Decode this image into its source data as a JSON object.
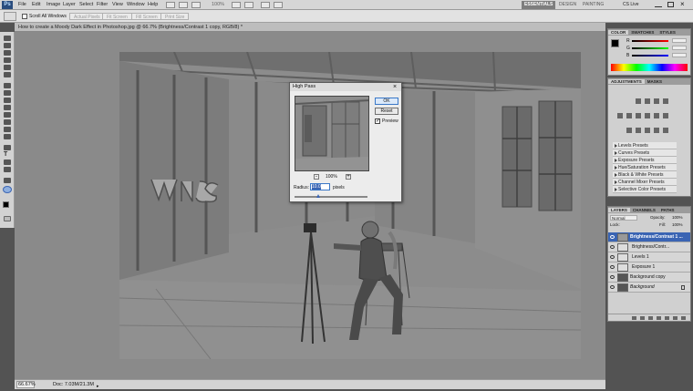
{
  "menubar": {
    "logo": "Ps",
    "items": [
      "File",
      "Edit",
      "Image",
      "Layer",
      "Select",
      "Filter",
      "View",
      "Window",
      "Help"
    ],
    "zoom": "100%",
    "workspaces": [
      "ESSENTIALS",
      "DESIGN",
      "PAINTING"
    ],
    "cs_live": "CS Live"
  },
  "options": {
    "scroll_all_windows": "Scroll All Windows",
    "actual_pixels": "Actual Pixels",
    "fit_screen": "Fit Screen",
    "fill_screen": "Fill Screen",
    "print_size": "Print Size"
  },
  "document": {
    "tab_title": "How to create a Moody Dark Effect in Photoshop.jpg @ 66.7% (Brightness/Contrast 1 copy, RGB/8) *",
    "zoom": "66.67%",
    "doc_size": "Doc: 7.03M/21.3M"
  },
  "high_pass": {
    "title": "High Pass",
    "ok": "OK",
    "cancel": "Reset",
    "preview": "Preview",
    "preview_checked": true,
    "preview_zoom": "100%",
    "radius_label": "Radius:",
    "radius_value": "10.0",
    "unit": "pixels",
    "radius_fraction": 0.3
  },
  "panels": {
    "color_tabs": [
      "COLOR",
      "SWATCHES",
      "STYLES"
    ],
    "color_channels": [
      "R",
      "G",
      "B"
    ],
    "adjustments_tabs": [
      "ADJUSTMENTS",
      "MASKS"
    ],
    "presets": [
      "Levels Presets",
      "Curves Presets",
      "Exposure Presets",
      "Hue/Saturation Presets",
      "Black & White Presets",
      "Channel Mixer Presets",
      "Selective Color Presets"
    ],
    "layers_tabs": [
      "LAYERS",
      "CHANNELS",
      "PATHS"
    ],
    "blend": "Normal",
    "opacity_label": "Opacity:",
    "opacity": "100%",
    "fill_label": "Fill:",
    "fill": "100%",
    "lock_label": "Lock:",
    "layers": [
      {
        "name": "Brightness/Contrast 1 ...",
        "selected": true
      },
      {
        "name": "Brightness/Contr...",
        "selected": false
      },
      {
        "name": "Levels 1",
        "selected": false
      },
      {
        "name": "Exposure 1",
        "selected": false
      },
      {
        "name": "Background copy",
        "selected": false
      },
      {
        "name": "Background",
        "selected": false
      }
    ]
  },
  "colors": {
    "accent": "#3a64b3",
    "ui_bg": "#535353",
    "panel_bg": "#d0d0d0"
  }
}
